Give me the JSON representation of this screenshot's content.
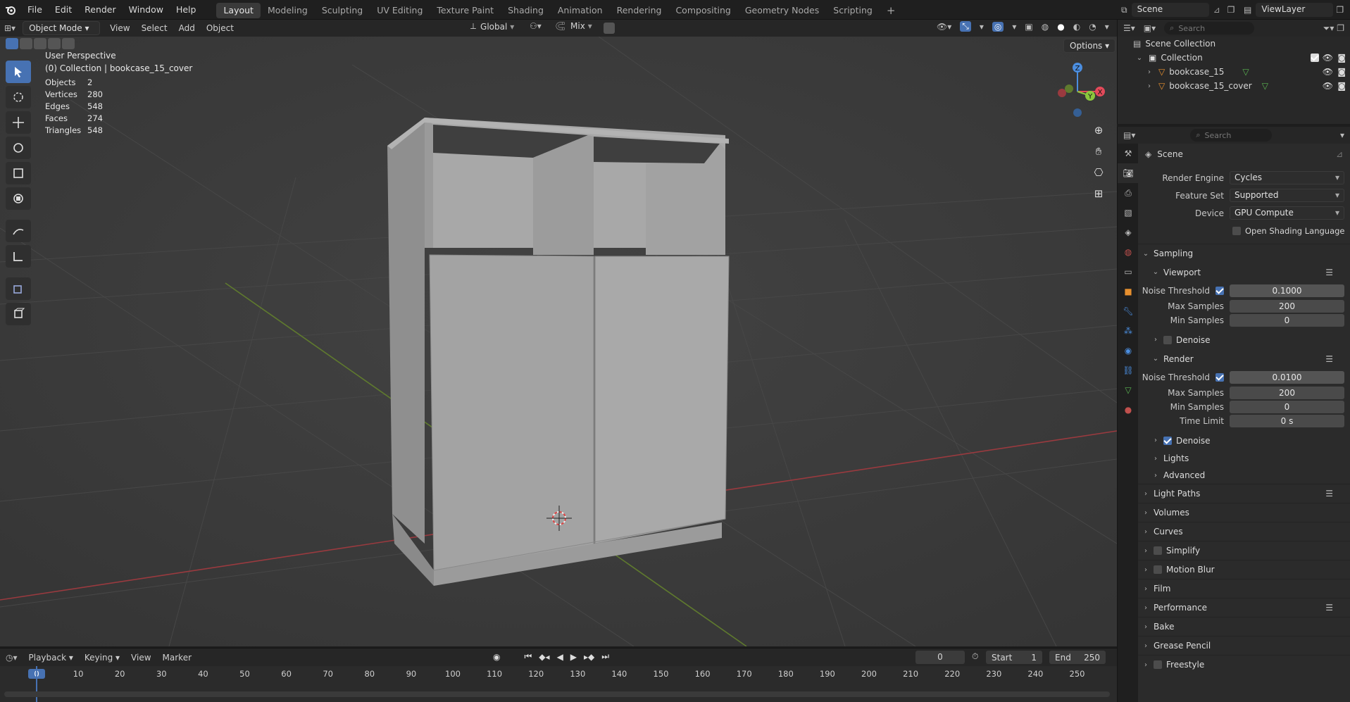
{
  "menu": [
    "File",
    "Edit",
    "Render",
    "Window",
    "Help"
  ],
  "workspaces": [
    "Layout",
    "Modeling",
    "Sculpting",
    "UV Editing",
    "Texture Paint",
    "Shading",
    "Animation",
    "Rendering",
    "Compositing",
    "Geometry Nodes",
    "Scripting"
  ],
  "active_workspace": "Layout",
  "scene_name": "Scene",
  "view_layer": "ViewLayer",
  "viewport_header": {
    "mode": "Object Mode",
    "menus": [
      "View",
      "Select",
      "Add",
      "Object"
    ],
    "orientation": "Global",
    "mix": "Mix",
    "options": "Options"
  },
  "overlay": {
    "perspective": "User Perspective",
    "collection": "(0) Collection | bookcase_15_cover",
    "stats": [
      {
        "label": "Objects",
        "value": "2"
      },
      {
        "label": "Vertices",
        "value": "280"
      },
      {
        "label": "Edges",
        "value": "548"
      },
      {
        "label": "Faces",
        "value": "274"
      },
      {
        "label": "Triangles",
        "value": "548"
      }
    ]
  },
  "gizmo": {
    "x": "X",
    "y": "Y",
    "z": "Z"
  },
  "timeline": {
    "menus": [
      "Playback",
      "Keying",
      "View",
      "Marker"
    ],
    "current_frame": "0",
    "start_label": "Start",
    "start": "1",
    "end_label": "End",
    "end": "250",
    "ticks": [
      "0",
      "10",
      "20",
      "30",
      "40",
      "50",
      "60",
      "70",
      "80",
      "90",
      "100",
      "110",
      "120",
      "130",
      "140",
      "150",
      "160",
      "170",
      "180",
      "190",
      "200",
      "210",
      "220",
      "230",
      "240",
      "250"
    ]
  },
  "outliner": {
    "search_placeholder": "Search",
    "scene_collection": "Scene Collection",
    "collection": "Collection",
    "objects": [
      "bookcase_15",
      "bookcase_15_cover"
    ]
  },
  "properties": {
    "search_placeholder": "Search",
    "context": "Scene",
    "render_engine_label": "Render Engine",
    "render_engine": "Cycles",
    "feature_set_label": "Feature Set",
    "feature_set": "Supported",
    "device_label": "Device",
    "device": "GPU Compute",
    "osl_label": "Open Shading Language",
    "sampling": "Sampling",
    "viewport": "Viewport",
    "noise_threshold_label": "Noise Threshold",
    "viewport_noise": "0.1000",
    "max_samples_label": "Max Samples",
    "viewport_max": "200",
    "min_samples_label": "Min Samples",
    "viewport_min": "0",
    "denoise_label": "Denoise",
    "render": "Render",
    "render_noise": "0.0100",
    "render_max": "200",
    "render_min": "0",
    "time_limit_label": "Time Limit",
    "time_limit": "0 s",
    "lights": "Lights",
    "advanced": "Advanced",
    "panels": [
      "Light Paths",
      "Volumes",
      "Curves",
      "Simplify",
      "Motion Blur",
      "Film",
      "Performance",
      "Bake",
      "Grease Pencil",
      "Freestyle"
    ]
  },
  "colors": {
    "accent": "#4772b3",
    "x_axis": "#e34a5a",
    "y_axis": "#8ac73d",
    "z_axis": "#4b8ee0"
  }
}
